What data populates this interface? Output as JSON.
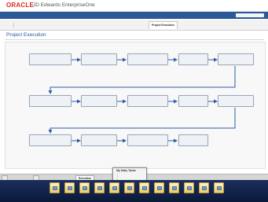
{
  "header": {
    "logo": "ORACLE",
    "product": "JD Edwards EnterpriseOne",
    "user_menu": [
      "",
      "",
      "",
      ""
    ]
  },
  "nav": {
    "items": [
      "",
      "",
      "",
      ""
    ],
    "search_placeholder": ""
  },
  "tabs": [
    "",
    "",
    "",
    "",
    "",
    "",
    "Project Execution",
    "",
    "",
    ""
  ],
  "page": {
    "title": "Project Execution"
  },
  "flow": {
    "row1": [
      "",
      "",
      "",
      "",
      ""
    ],
    "row2": [
      "",
      "",
      "",
      "",
      ""
    ],
    "row3": [
      "",
      "",
      "",
      ""
    ]
  },
  "popup": {
    "title": "My Daily Tasks",
    "items": [
      "",
      "",
      "",
      "",
      "",
      ""
    ]
  },
  "bottom_tabs": [
    "",
    "",
    "Execution"
  ],
  "dock": {
    "items": [
      "",
      "",
      "",
      "",
      "",
      "",
      "",
      "",
      "",
      "",
      "",
      ""
    ]
  }
}
